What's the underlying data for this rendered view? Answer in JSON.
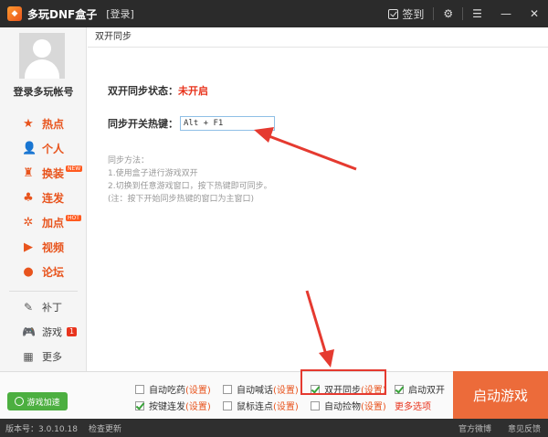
{
  "titlebar": {
    "app_title": "多玩DNF盒子",
    "login_link": "[登录]",
    "checkin_label": "签到",
    "settings_icon": "gear-icon",
    "menu_icon": "menu-icon",
    "minimize_icon": "minimize-icon",
    "close_icon": "close-icon"
  },
  "sidebar": {
    "account_label": "登录多玩帐号",
    "items": [
      {
        "label": "热点",
        "icon": "star-icon"
      },
      {
        "label": "个人",
        "icon": "person-icon"
      },
      {
        "label": "换装",
        "icon": "outfit-icon",
        "badge": "NEW"
      },
      {
        "label": "连发",
        "icon": "tree-icon"
      },
      {
        "label": "加点",
        "icon": "points-icon",
        "badge": "HOT"
      },
      {
        "label": "视频",
        "icon": "play-icon"
      },
      {
        "label": "论坛",
        "icon": "chat-icon"
      }
    ],
    "secondary": [
      {
        "label": "补丁",
        "icon": "patch-icon"
      },
      {
        "label": "游戏",
        "icon": "gamepad-icon",
        "count": "1"
      },
      {
        "label": "更多",
        "icon": "grid-icon"
      }
    ]
  },
  "main": {
    "breadcrumb": "双开同步",
    "status_label": "双开同步状态：",
    "status_value": "未开启",
    "hotkey_label": "同步开关热键：",
    "hotkey_value": "Alt + F1",
    "help_title": "同步方法：",
    "help_line1": "1.使用盒子进行游戏双开",
    "help_line2": "2.切换到任意游戏窗口，按下热键即可同步。",
    "help_note": "(注：按下开始同步热键的窗口为主窗口)"
  },
  "optionbar": {
    "speed_button": "游戏加速",
    "options": [
      {
        "label": "自动吃药",
        "link": "(设置)",
        "checked": false
      },
      {
        "label": "自动喊话",
        "link": "(设置)",
        "checked": false
      },
      {
        "label": "双开同步",
        "link": "(设置)",
        "checked": true
      },
      {
        "label": "启动双开",
        "link": "",
        "checked": true
      },
      {
        "label": "按键连发",
        "link": "(设置)",
        "checked": true
      },
      {
        "label": "鼠标连点",
        "link": "(设置)",
        "checked": false
      },
      {
        "label": "自动捡物",
        "link": "(设置)",
        "checked": false
      }
    ],
    "more_link": "更多选项",
    "start_button": "启动游戏"
  },
  "statusbar": {
    "version": "版本号：3.0.10.18",
    "check_update": "检查更新",
    "weibo": "官方微博",
    "feedback": "意见反馈"
  },
  "colors": {
    "accent": "#e8541d",
    "start_button": "#ec6b3a",
    "speed_button": "#4caf40",
    "annotation_red": "#e53a30"
  }
}
